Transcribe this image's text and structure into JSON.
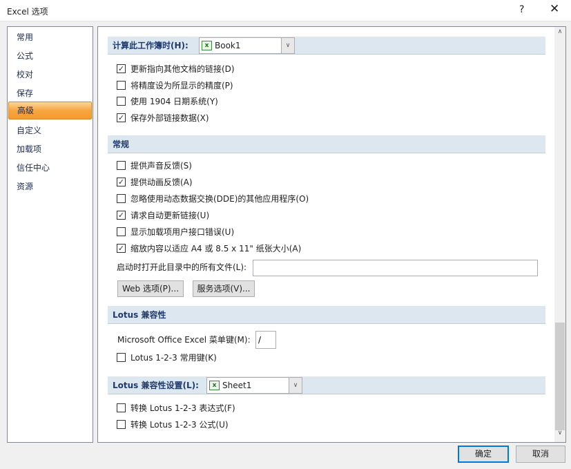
{
  "window": {
    "title": "Excel 选项",
    "help": "?",
    "close": "✕"
  },
  "nav": {
    "items": [
      "常用",
      "公式",
      "校对",
      "保存",
      "高级",
      "自定义",
      "加载项",
      "信任中心",
      "资源"
    ],
    "selected": "高级"
  },
  "workbook_section": {
    "label": "计算此工作簿时(H):",
    "combo_value": "Book1",
    "options": [
      {
        "label": "更新指向其他文档的链接(D)",
        "checked": true
      },
      {
        "label": "将精度设为所显示的精度(P)",
        "checked": false
      },
      {
        "label": "使用 1904 日期系统(Y)",
        "checked": false
      },
      {
        "label": "保存外部链接数据(X)",
        "checked": true
      }
    ]
  },
  "general_section": {
    "label": "常规",
    "options": [
      {
        "label": "提供声音反馈(S)",
        "checked": false
      },
      {
        "label": "提供动画反馈(A)",
        "checked": true
      },
      {
        "label": "忽略使用动态数据交换(DDE)的其他应用程序(O)",
        "checked": false
      },
      {
        "label": "请求自动更新链接(U)",
        "checked": true
      },
      {
        "label": "显示加载项用户接口错误(U)",
        "checked": false
      },
      {
        "label": "缩放内容以适应 A4 或 8.5 x 11\" 纸张大小(A)",
        "checked": true
      }
    ],
    "startup_label": "启动时打开此目录中的所有文件(L):",
    "startup_value": "",
    "web_options": "Web 选项(P)...",
    "service_options": "服务选项(V)..."
  },
  "lotus_section": {
    "label": "Lotus 兼容性",
    "menu_key_label": "Microsoft Office Excel 菜单键(M):",
    "menu_key_value": "/",
    "options": [
      {
        "label": "Lotus 1-2-3 常用键(K)",
        "checked": false
      }
    ]
  },
  "lotus_settings_section": {
    "label": "Lotus 兼容性设置(L):",
    "combo_value": "Sheet1",
    "options": [
      {
        "label": "转换 Lotus 1-2-3 表达式(F)",
        "checked": false
      },
      {
        "label": "转换 Lotus 1-2-3 公式(U)",
        "checked": false
      }
    ]
  },
  "scroll": {
    "position_fraction": 1.0
  },
  "footer": {
    "ok": "确定",
    "cancel": "取消"
  },
  "colors": {
    "section_bg": "#dde7ef",
    "nav_selected": "#f7a540",
    "ok_border": "#0078d7"
  }
}
